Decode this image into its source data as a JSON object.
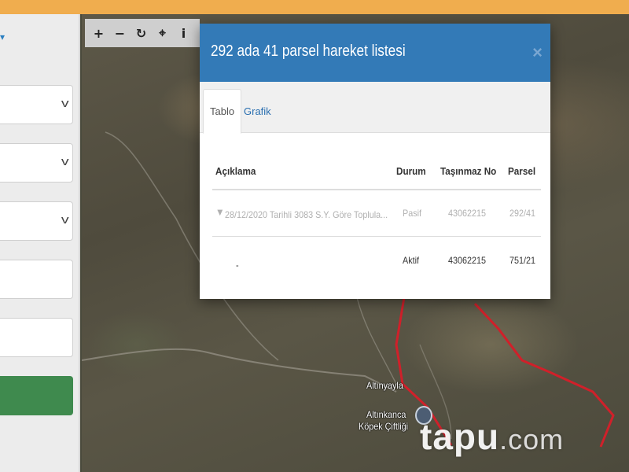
{
  "map_toolbar": {
    "tools": [
      {
        "name": "zoom-in-icon",
        "glyph": "+"
      },
      {
        "name": "zoom-out-icon",
        "glyph": "−"
      },
      {
        "name": "refresh-icon",
        "glyph": "↻"
      },
      {
        "name": "locate-icon",
        "glyph": "⌖"
      },
      {
        "name": "info-icon",
        "glyph": "i"
      }
    ]
  },
  "modal": {
    "title": "292 ada 41 parsel hareket listesi",
    "close_glyph": "×",
    "tabs": [
      {
        "label": "Tablo",
        "active": true
      },
      {
        "label": "Grafik",
        "active": false
      }
    ],
    "table": {
      "headers": [
        "Açıklama",
        "Durum",
        "Taşınmaz No",
        "Parsel"
      ],
      "rows": [
        {
          "expand_glyph": "▼",
          "description": "28/12/2020 Tarihli 3083 S.Y. Göre Toplula...",
          "status": "Pasif",
          "tasinmaz_no": "43062215",
          "parsel": "292/41"
        },
        {
          "expand_glyph": "",
          "description": "-",
          "status": "Aktif",
          "tasinmaz_no": "43062215",
          "parsel": "751/21"
        }
      ]
    }
  },
  "map_labels": {
    "place1": "Altınyayla",
    "place2": "Altınkanca",
    "place3": "Köpek Çiftliği"
  },
  "watermark": {
    "brand": "tapu",
    "suffix": ".com"
  },
  "colors": {
    "topbar": "#f0ad4e",
    "modal_header": "#337ab7",
    "boundary": "#d0202a",
    "action_button": "#3f8a4e"
  }
}
